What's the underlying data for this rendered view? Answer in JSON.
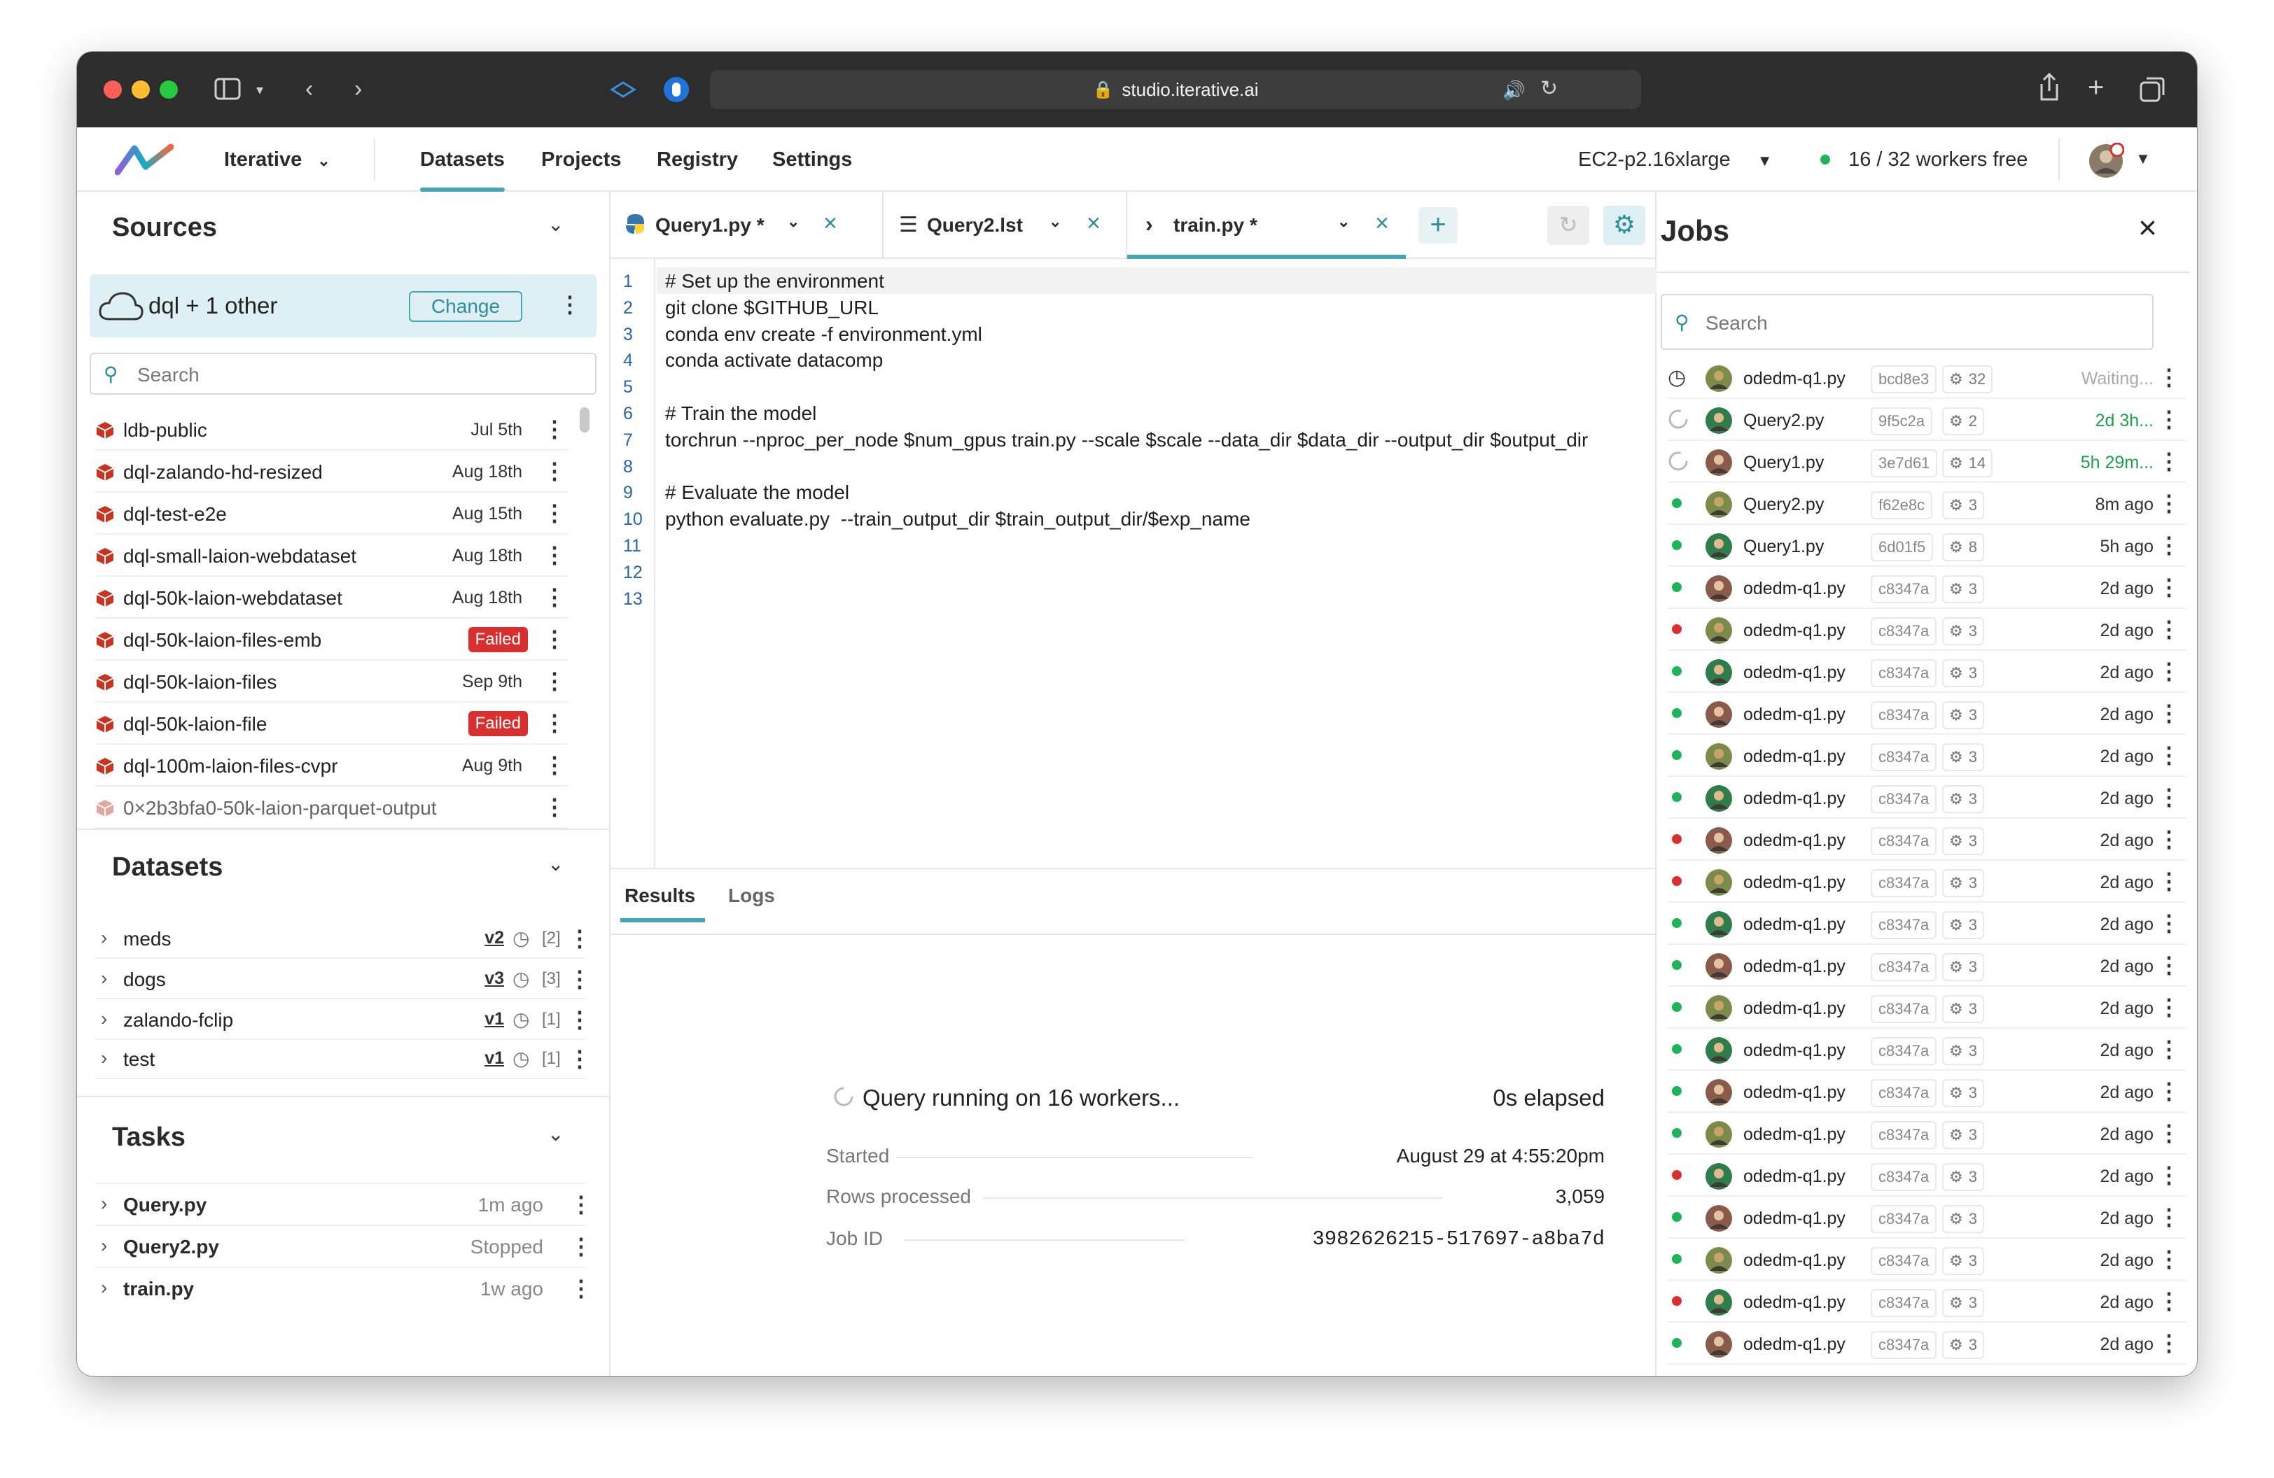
{
  "browser": {
    "url": "studio.iterative.ai"
  },
  "header": {
    "org": "Iterative",
    "nav": [
      "Datasets",
      "Projects",
      "Registry",
      "Settings"
    ],
    "active_nav": "Datasets",
    "instance": "EC2-p2.16xlarge",
    "workers_free": "16 / 32 workers free"
  },
  "sources": {
    "title": "Sources",
    "selected": "dql + 1 other",
    "change_label": "Change",
    "search_placeholder": "Search",
    "items": [
      {
        "name": "ldb-public",
        "date": "Jul 5th"
      },
      {
        "name": "dql-zalando-hd-resized",
        "date": "Aug 18th"
      },
      {
        "name": "dql-test-e2e",
        "date": "Aug 15th"
      },
      {
        "name": "dql-small-laion-webdataset",
        "date": "Aug 18th"
      },
      {
        "name": "dql-50k-laion-webdataset",
        "date": "Aug 18th"
      },
      {
        "name": "dql-50k-laion-files-emb",
        "badge": "Failed"
      },
      {
        "name": "dql-50k-laion-files",
        "date": "Sep 9th"
      },
      {
        "name": "dql-50k-laion-file",
        "badge": "Failed"
      },
      {
        "name": "dql-100m-laion-files-cvpr",
        "date": "Aug 9th"
      },
      {
        "name": "0×2b3bfa0-50k-laion-parquet-output",
        "date": ""
      }
    ]
  },
  "datasets": {
    "title": "Datasets",
    "items": [
      {
        "name": "meds",
        "version": "v2",
        "count": "[2]"
      },
      {
        "name": "dogs",
        "version": "v3",
        "count": "[3]"
      },
      {
        "name": "zalando-fclip",
        "version": "v1",
        "count": "[1]"
      },
      {
        "name": "test",
        "version": "v1",
        "count": "[1]"
      }
    ]
  },
  "tasks": {
    "title": "Tasks",
    "items": [
      {
        "name": "Query.py",
        "status": "1m ago"
      },
      {
        "name": "Query2.py",
        "status": "Stopped"
      },
      {
        "name": "train.py",
        "status": "1w ago"
      }
    ]
  },
  "editor": {
    "tabs": [
      {
        "label": "Query1.py *",
        "icon": "python-icon"
      },
      {
        "label": "Query2.lst",
        "icon": "list-icon"
      },
      {
        "label": "train.py *",
        "icon": "terminal-icon"
      }
    ],
    "active_tab": "train.py *",
    "lines": [
      "# Set up the environment",
      "git clone $GITHUB_URL",
      "conda env create -f environment.yml",
      "conda activate datacomp",
      "",
      "# Train the model",
      "torchrun --nproc_per_node $num_gpus train.py --scale $scale --data_dir $data_dir --output_dir $output_dir",
      "",
      "# Evaluate the model",
      "python evaluate.py  --train_output_dir $train_output_dir/$exp_name",
      "",
      "",
      ""
    ],
    "line_numbers": [
      "1",
      "2",
      "3",
      "4",
      "5",
      "6",
      "7",
      "8",
      "9",
      "10",
      "11",
      "12",
      "13"
    ]
  },
  "results": {
    "tabs": [
      "Results",
      "Logs"
    ],
    "active": "Results",
    "running": "Query running on 16 workers...",
    "elapsed": "0s elapsed",
    "stats": [
      {
        "label": "Started",
        "value": "August 29 at 4:55:20pm"
      },
      {
        "label": "Rows processed",
        "value": "3,059"
      },
      {
        "label": "Job ID",
        "value": "3982626215-517697-a8ba7d"
      }
    ]
  },
  "jobs": {
    "title": "Jobs",
    "search_placeholder": "Search",
    "items": [
      {
        "name": "odedm-q1.py",
        "hash": "bcd8e3",
        "workers": "32",
        "when": "Waiting...",
        "status": "queued",
        "when_color": "#aaaaaa"
      },
      {
        "name": "Query2.py",
        "hash": "9f5c2a",
        "workers": "2",
        "when": "2d 3h...",
        "status": "running",
        "when_color": "#1aa34a"
      },
      {
        "name": "Query1.py",
        "hash": "3e7d61",
        "workers": "14",
        "when": "5h 29m...",
        "status": "running",
        "when_color": "#1aa34a"
      },
      {
        "name": "Query2.py",
        "hash": "f62e8c",
        "workers": "3",
        "when": "8m ago",
        "status": "success"
      },
      {
        "name": "Query1.py",
        "hash": "6d01f5",
        "workers": "8",
        "when": "5h ago",
        "status": "success"
      },
      {
        "name": "odedm-q1.py",
        "hash": "c8347a",
        "workers": "3",
        "when": "2d ago",
        "status": "success"
      },
      {
        "name": "odedm-q1.py",
        "hash": "c8347a",
        "workers": "3",
        "when": "2d ago",
        "status": "failed"
      },
      {
        "name": "odedm-q1.py",
        "hash": "c8347a",
        "workers": "3",
        "when": "2d ago",
        "status": "success"
      },
      {
        "name": "odedm-q1.py",
        "hash": "c8347a",
        "workers": "3",
        "when": "2d ago",
        "status": "success"
      },
      {
        "name": "odedm-q1.py",
        "hash": "c8347a",
        "workers": "3",
        "when": "2d ago",
        "status": "success"
      },
      {
        "name": "odedm-q1.py",
        "hash": "c8347a",
        "workers": "3",
        "when": "2d ago",
        "status": "success"
      },
      {
        "name": "odedm-q1.py",
        "hash": "c8347a",
        "workers": "3",
        "when": "2d ago",
        "status": "failed"
      },
      {
        "name": "odedm-q1.py",
        "hash": "c8347a",
        "workers": "3",
        "when": "2d ago",
        "status": "failed"
      },
      {
        "name": "odedm-q1.py",
        "hash": "c8347a",
        "workers": "3",
        "when": "2d ago",
        "status": "success"
      },
      {
        "name": "odedm-q1.py",
        "hash": "c8347a",
        "workers": "3",
        "when": "2d ago",
        "status": "success"
      },
      {
        "name": "odedm-q1.py",
        "hash": "c8347a",
        "workers": "3",
        "when": "2d ago",
        "status": "success"
      },
      {
        "name": "odedm-q1.py",
        "hash": "c8347a",
        "workers": "3",
        "when": "2d ago",
        "status": "success"
      },
      {
        "name": "odedm-q1.py",
        "hash": "c8347a",
        "workers": "3",
        "when": "2d ago",
        "status": "success"
      },
      {
        "name": "odedm-q1.py",
        "hash": "c8347a",
        "workers": "3",
        "when": "2d ago",
        "status": "success"
      },
      {
        "name": "odedm-q1.py",
        "hash": "c8347a",
        "workers": "3",
        "when": "2d ago",
        "status": "failed"
      },
      {
        "name": "odedm-q1.py",
        "hash": "c8347a",
        "workers": "3",
        "when": "2d ago",
        "status": "success"
      },
      {
        "name": "odedm-q1.py",
        "hash": "c8347a",
        "workers": "3",
        "when": "2d ago",
        "status": "success"
      },
      {
        "name": "odedm-q1.py",
        "hash": "c8347a",
        "workers": "3",
        "when": "2d ago",
        "status": "failed"
      },
      {
        "name": "odedm-q1.py",
        "hash": "c8347a",
        "workers": "3",
        "when": "2d ago",
        "status": "success"
      }
    ]
  },
  "colors": {
    "accent": "#46a6b6",
    "success": "#1fb35a",
    "failed": "#d9302f",
    "source_icon": "#c8341f"
  }
}
